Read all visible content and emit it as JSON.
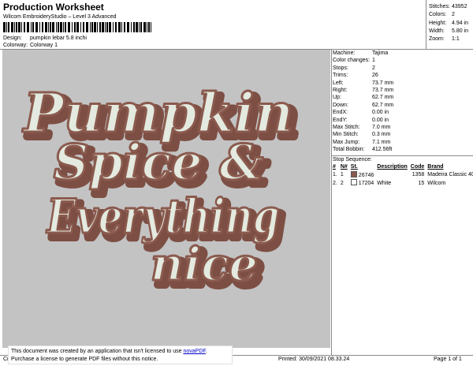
{
  "header": {
    "title": "Production Worksheet",
    "subtitle": "Wilcom EmbroideryStudio – Level 3 Advanced",
    "design_label": "Design:",
    "design_value": "pumpkin lebar 5.8 inchi",
    "colorway_label": "Colorway:",
    "colorway_value": "Colorway 1"
  },
  "stats": [
    {
      "label": "Stitches:",
      "value": "43952"
    },
    {
      "label": "Colors:",
      "value": "2"
    },
    {
      "label": "Height:",
      "value": "4.94 in"
    },
    {
      "label": "Width:",
      "value": "5.80 in"
    },
    {
      "label": "Zoom:",
      "value": "1:1"
    }
  ],
  "machine": [
    {
      "label": "Machine:",
      "value": "Tajima"
    },
    {
      "label": "Color changes:",
      "value": "1"
    },
    {
      "label": "Stops:",
      "value": "2"
    },
    {
      "label": "Trims:",
      "value": "26"
    },
    {
      "label": "Left:",
      "value": "73.7 mm"
    },
    {
      "label": "Right:",
      "value": "73.7 mm"
    },
    {
      "label": "Up:",
      "value": "62.7 mm"
    },
    {
      "label": "Down:",
      "value": "62.7 mm"
    },
    {
      "label": "EndX:",
      "value": "0.00 in"
    },
    {
      "label": "EndY:",
      "value": "0.00 in"
    },
    {
      "label": "Max Stitch:",
      "value": "7.0 mm"
    },
    {
      "label": "Min Stitch:",
      "value": "0.3 mm"
    },
    {
      "label": "Max Jump:",
      "value": "7.1 mm"
    },
    {
      "label": "Total Bobbin:",
      "value": "412.56ft"
    }
  ],
  "stop_sequence": {
    "title": "Stop Sequence:",
    "headers": [
      "#",
      "N#",
      "St.",
      "Description",
      "Code",
      "Brand"
    ],
    "rows": [
      {
        "num": "1.",
        "needle": "1",
        "stitches": "26746",
        "description": "",
        "code": "1358",
        "brand": "Madeira Classic 40",
        "color": "#8b5a4e"
      },
      {
        "num": "2.",
        "needle": "2",
        "stitches": "17204",
        "description": "White",
        "code": "15",
        "brand": "Wilcom",
        "color": "#ffffff"
      }
    ]
  },
  "design": {
    "lines": [
      "Pumpkin",
      "Spice &",
      "Everything",
      "nice"
    ],
    "fill_color": "#e4eadf",
    "outline_color": "#8b5a4e",
    "shadow_color": "#7d4f44",
    "background": "#c3c3c3"
  },
  "notice": {
    "line1_prefix": "This document was created by an application that isn't licensed to use ",
    "line1_link": "novaPDF",
    "line1_suffix": ".",
    "line2": "Purchase a license to generate PDF files without this notice."
  },
  "footer": {
    "left": "Cr",
    "printed": "Printed: 30/09/2021 08.33.24",
    "page": "Page 1 of 1"
  }
}
